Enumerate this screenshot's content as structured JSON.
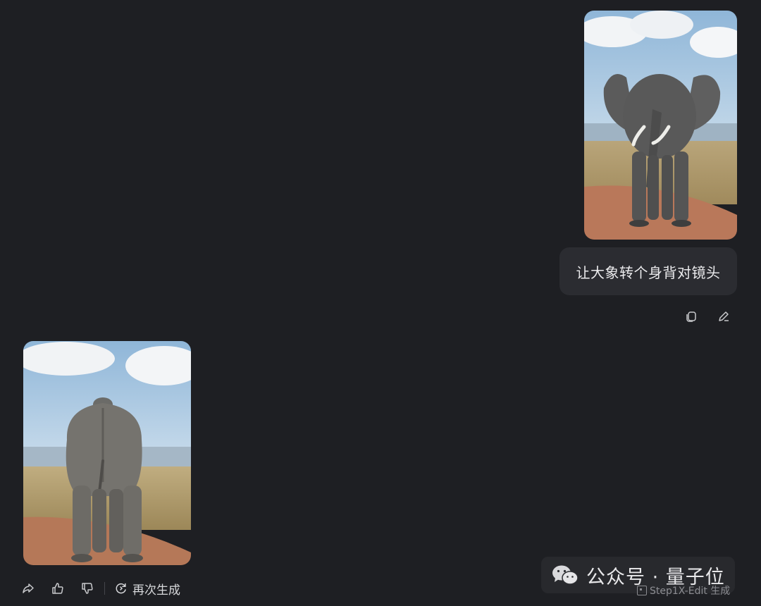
{
  "conversation": {
    "user_message": "让大象转个身背对镜头",
    "user_image_alt": "elephant facing camera",
    "ai_image_alt": "elephant facing away from camera"
  },
  "message_actions": {
    "copy_icon": "copy-icon",
    "edit_icon": "edit-icon"
  },
  "response_actions": {
    "share_icon": "share-icon",
    "like_icon": "thumbs-up-icon",
    "dislike_icon": "thumbs-down-icon",
    "regenerate_label": "再次生成"
  },
  "watermark": {
    "text": "公众号 · 量子位",
    "credit": "Step1X-Edit 生成"
  }
}
